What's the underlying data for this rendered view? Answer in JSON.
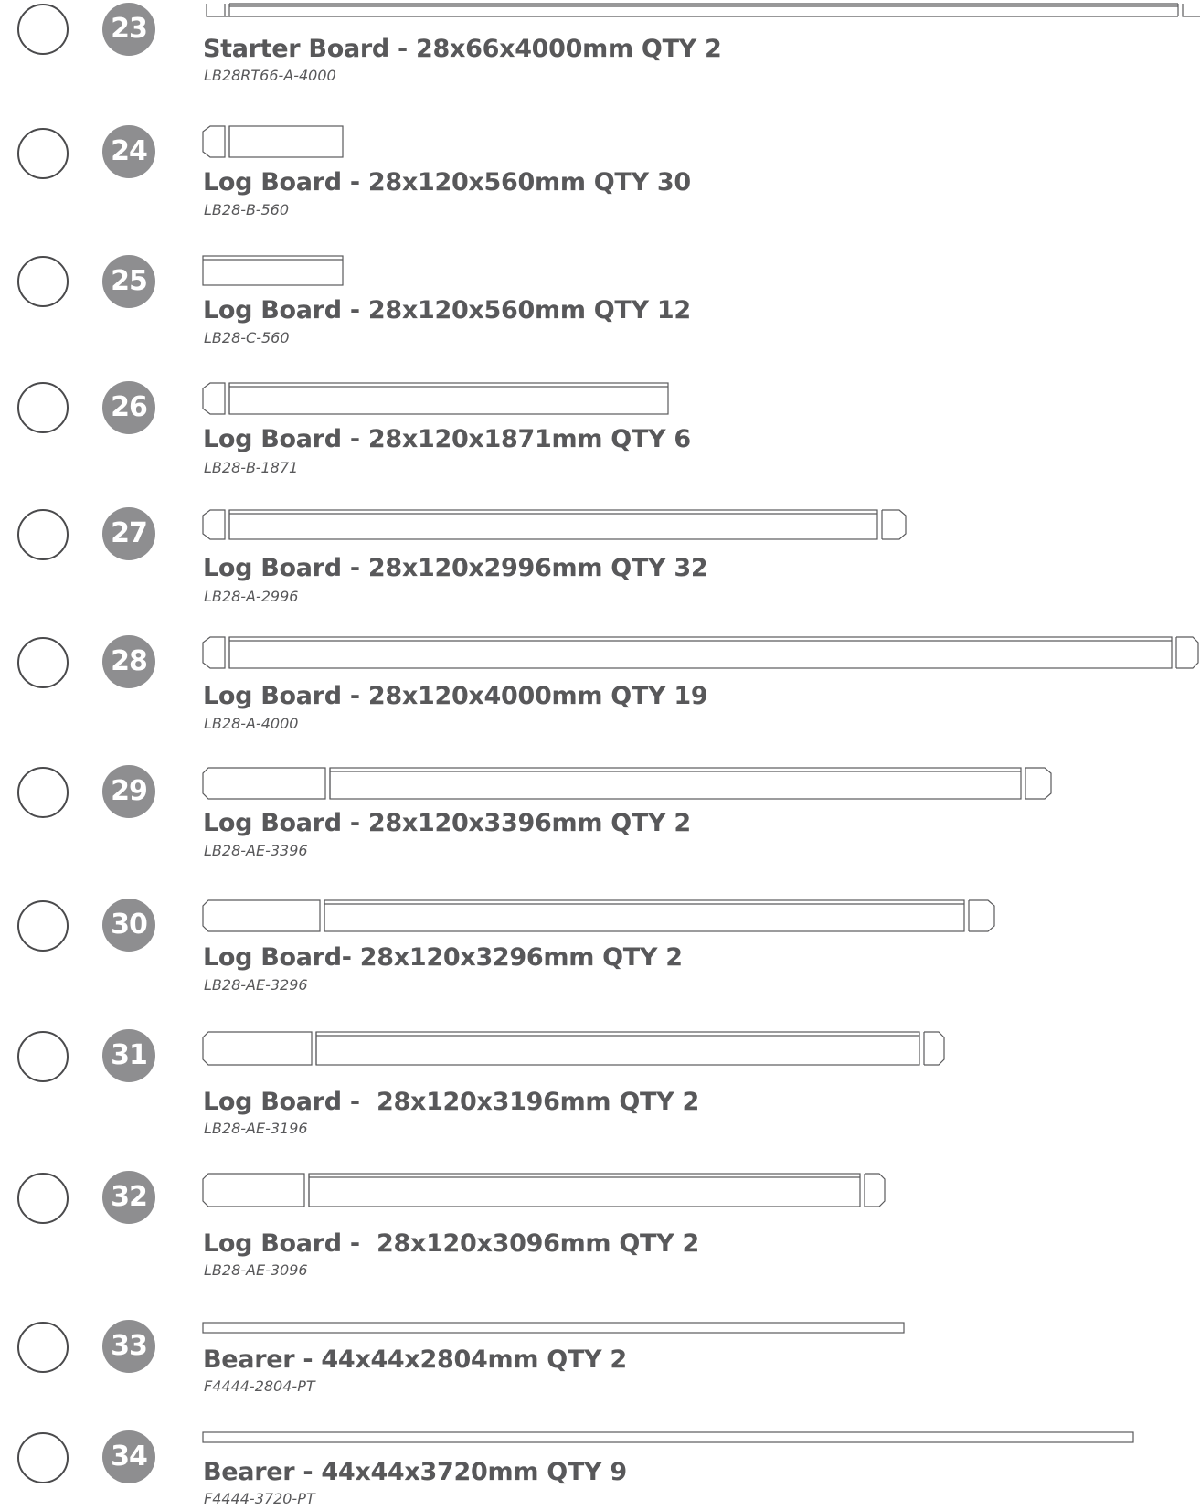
{
  "items": [
    {
      "number": "23",
      "title": "Starter Board - 28x66x4000mm QTY 2",
      "code": "LB28RT66-A-4000",
      "shape": "starter-board"
    },
    {
      "number": "24",
      "title": "Log Board - 28x120x560mm QTY 30",
      "code": "LB28-B-560",
      "shape": "board-tenon-left"
    },
    {
      "number": "25",
      "title": "Log Board - 28x120x560mm QTY 12",
      "code": "LB28-C-560",
      "shape": "plain-board"
    },
    {
      "number": "26",
      "title": "Log Board - 28x120x1871mm QTY 6",
      "code": "LB28-B-1871",
      "shape": "board-tenon-left"
    },
    {
      "number": "27",
      "title": "Log Board - 28x120x2996mm QTY 32",
      "code": "LB28-A-2996",
      "shape": "board-tenon-both"
    },
    {
      "number": "28",
      "title": "Log Board - 28x120x4000mm QTY 19",
      "code": "LB28-A-4000",
      "shape": "board-tenon-both"
    },
    {
      "number": "29",
      "title": "Log Board - 28x120x3396mm QTY 2",
      "code": "LB28-AE-3396",
      "shape": "board-end-section"
    },
    {
      "number": "30",
      "title": "Log Board- 28x120x3296mm QTY 2",
      "code": "LB28-AE-3296",
      "shape": "board-end-section"
    },
    {
      "number": "31",
      "title": "Log Board -  28x120x3196mm QTY 2",
      "code": "LB28-AE-3196",
      "shape": "board-end-section"
    },
    {
      "number": "32",
      "title": "Log Board -  28x120x3096mm QTY 2",
      "code": "LB28-AE-3096",
      "shape": "board-end-section"
    },
    {
      "number": "33",
      "title": "Bearer - 44x44x2804mm QTY 2",
      "code": "F4444-2804-PT",
      "shape": "bearer"
    },
    {
      "number": "34",
      "title": "Bearer - 44x44x3720mm QTY 9",
      "code": "F4444-3720-PT",
      "shape": "bearer"
    }
  ]
}
